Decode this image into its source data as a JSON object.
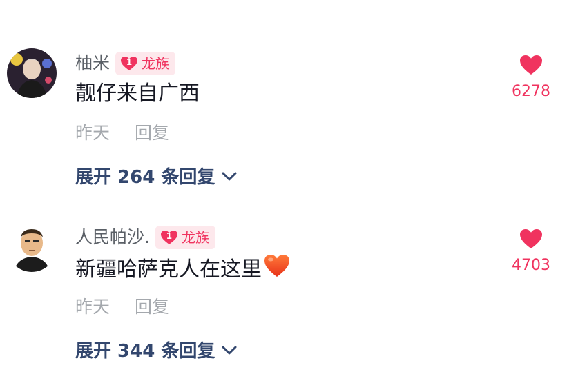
{
  "comments": [
    {
      "username": "柚米",
      "badge": {
        "level": "1",
        "label": "龙族"
      },
      "text": "靓仔来自广西",
      "time": "昨天",
      "reply_label": "回复",
      "expand_label": "展开 264 条回复",
      "likes": "6278"
    },
    {
      "username": "人民帕沙.",
      "badge": {
        "level": "1",
        "label": "龙族"
      },
      "text": "新疆哈萨克人在这里",
      "time": "昨天",
      "reply_label": "回复",
      "expand_label": "展开 344 条回复",
      "likes": "4703"
    }
  ],
  "colors": {
    "like_red": "#f0335f",
    "badge_bg": "#fde8ec",
    "expand_blue": "#33476e",
    "meta_gray": "#a4a8ad"
  }
}
